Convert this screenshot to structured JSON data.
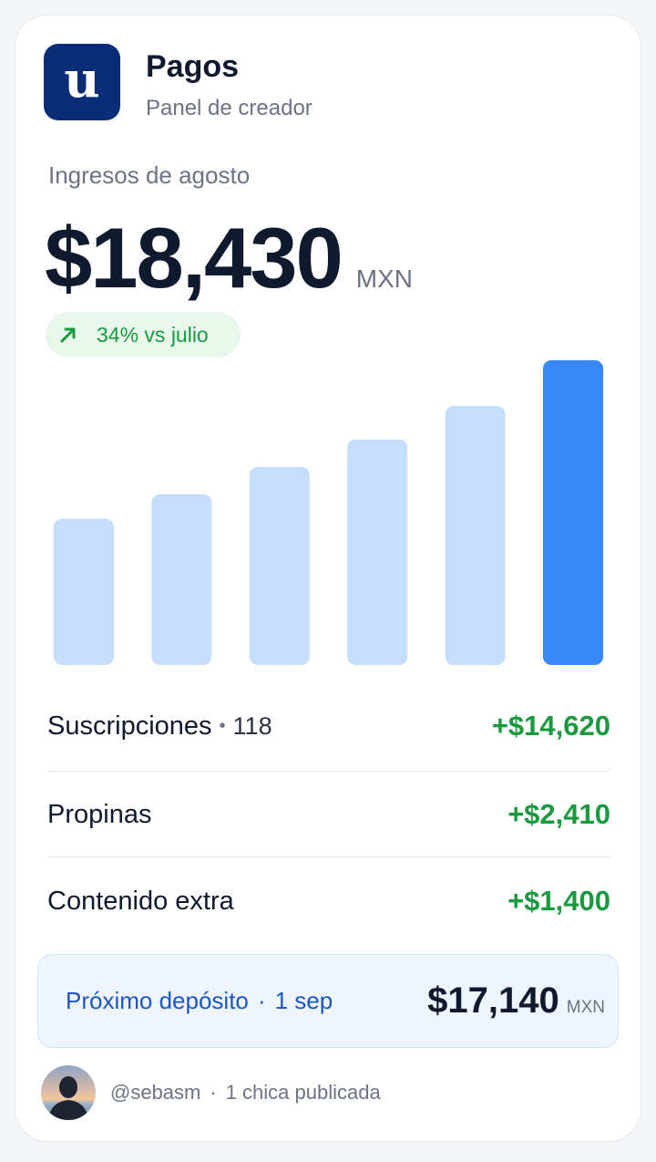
{
  "app": {
    "logo_letter": "u",
    "title": "Pagos",
    "subtitle": "Panel de creador"
  },
  "summary": {
    "period_label": "Ingresos de agosto",
    "amount": "$18,430",
    "currency": "MXN",
    "change_text": "34% vs julio",
    "change_icon": "arrow-up-right-icon"
  },
  "chart_data": {
    "type": "bar",
    "values": [
      0.48,
      0.56,
      0.65,
      0.74,
      0.85,
      1.0
    ],
    "highlight_index": 5,
    "colors": {
      "normal": "#c5defb",
      "highlight": "#3a87f7"
    }
  },
  "breakdown": [
    {
      "name": "Suscripciones",
      "count": "118",
      "amount": "+$14,620"
    },
    {
      "name": "Propinas",
      "count": "",
      "amount": "+$2,410"
    },
    {
      "name": "Contenido extra",
      "count": "",
      "amount": "+$1,400"
    }
  ],
  "deposit": {
    "label": "Próximo depósito",
    "date": "1 sep",
    "amount": "$17,140",
    "currency": "MXN"
  },
  "footer": {
    "handle": "@sebasm",
    "note": "1 chica publicada"
  },
  "colors": {
    "brand": "#0a2d78",
    "positive": "#1a9a3f",
    "accent": "#3a87f7",
    "link": "#1d56c2"
  }
}
